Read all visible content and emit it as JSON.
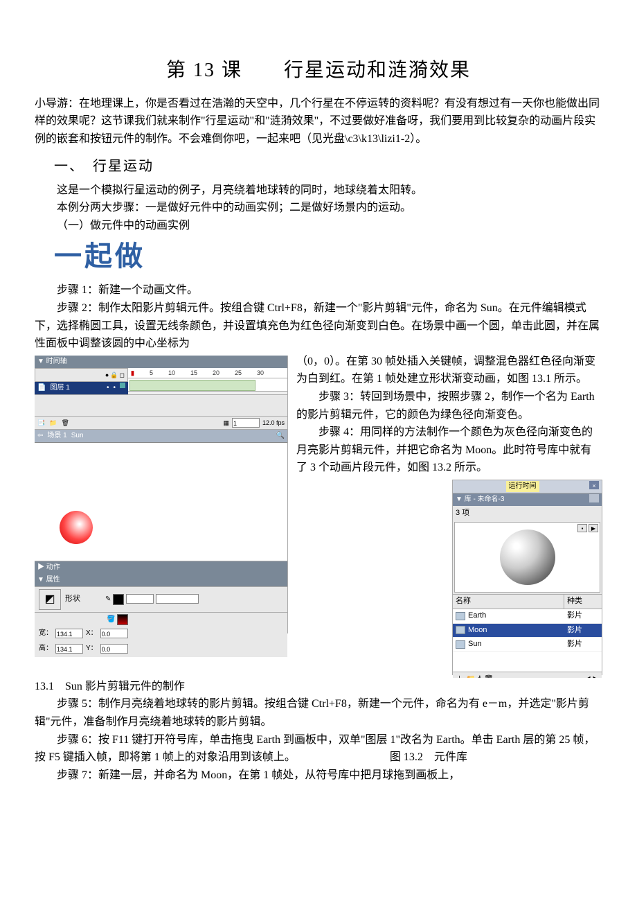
{
  "title": "第 13 课　　行星运动和涟漪效果",
  "intro": "小导游：在地理课上，你是否看过在浩瀚的天空中，几个行星在不停运转的资料呢？有没有想过有一天你也能做出同样的效果呢？这节课我们就来制作\"行星运动\"和\"涟漪效果\"，不过要做好准备呀，我们要用到比较复杂的动画片段实例的嵌套和按钮元件的制作。不会难倒你吧，一起来吧（见光盘\\c3\\k13\\lizi1-2）。",
  "sectionHead": "一、　行星运动",
  "line1": "这是一个模拟行星运动的例子，月亮绕着地球转的同时，地球绕着太阳转。",
  "line2": "本例分两大步骤：一是做好元件中的动画实例；二是做好场景内的运动。",
  "line3": "（一）做元件中的动画实例",
  "cnHead": "一起做",
  "step1": "步骤 1：新建一个动画文件。",
  "step2": "步骤 2：制作太阳影片剪辑元件。按组合键 Ctrl+F8，新建一个\"影片剪辑\"元件，命名为 Sun。在元件编辑模式下，选择椭圆工具，设置无线条颜色，并设置填充色为红色径向渐变到白色。在场景中画一个圆，单击此圆，并在属性面板中调整该圆的中心坐标为",
  "answer1": "（0，0）。在第 30 帧处插入关键帧，调整混色器红色径向渐变为白到红。在第 1 帧处建立形状渐变动画，如图 13.1 所示。",
  "step3": "步骤 3：转回到场景中，按照步骤 2，制作一个名为 Earth 的影片剪辑元件，它的颜色为绿色径向渐变色。",
  "step4": "步骤 4：用同样的方法制作一个颜色为灰色径向渐变色的月亮影片剪辑元件，并把它命名为 Moon。此时符号库中就有了 3 个动画片段元件，如图 13.2 所示。",
  "figW": "图",
  "fig1": "13.1　Sun 影片剪辑元件的制作",
  "step5": "步骤 5：制作月亮绕着地球转的影片剪辑。按组合键 Ctrl+F8，新建一个元件，命名为有 e－m，并选定\"影片剪辑\"元件，准备制作月亮绕着地球转的影片剪辑。",
  "step6": "步骤 6：按 F11 键打开符号库，单击拖曳 Earth 到画板中，双单\"图层 1\"改名为 Earth。单击 Earth 层的第 25 帧，按 F5 键插入帧，即将第 1 帧上的对象沿用到该帧上。",
  "fig2caption": "图 13.2　元件库",
  "step7": "步骤 7：新建一层，并命名为 Moon，在第 1 帧处，从符号库中把月球拖到画板上，",
  "flash": {
    "timelineTitle": "▼ 时间轴",
    "layerName": "图层 1",
    "ruler": [
      "5",
      "10",
      "15",
      "20",
      "25",
      "30"
    ],
    "frameBox": "1",
    "fps": "12.0 fps",
    "sceneBar1": "场景 1",
    "sceneBar2": "Sun",
    "actionTitle": "▶ 动作",
    "propTitle": "▼ 属性",
    "shapeLabel": "形状",
    "widthLabel": "宽：",
    "heightLabel": "高：",
    "xLabel": "X：",
    "yLabel": "Y：",
    "widthVal": "134.1",
    "heightVal": "134.1",
    "xVal": "0.0",
    "yVal": "0.0"
  },
  "library": {
    "runLabel": "运行时间",
    "titleBar": "▼ 库 - 未命名-3",
    "count": "3 项",
    "colName": "名称",
    "colKind": "种类",
    "rows": [
      {
        "name": "Earth",
        "kind": "影片"
      },
      {
        "name": "Moon",
        "kind": "影片"
      },
      {
        "name": "Sun",
        "kind": "影片"
      }
    ]
  }
}
